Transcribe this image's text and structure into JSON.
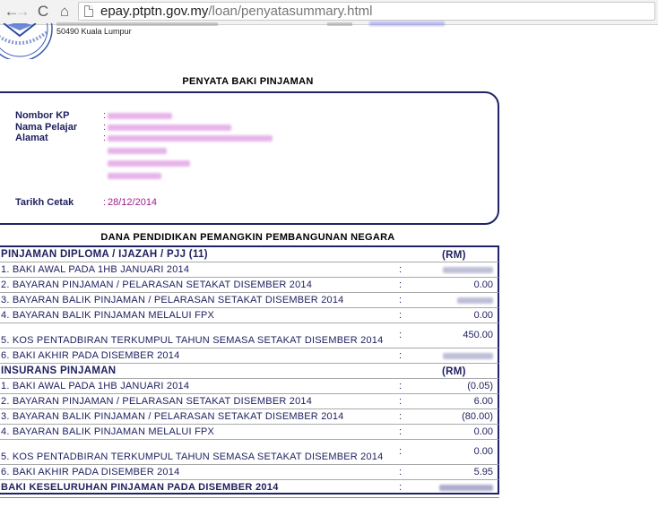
{
  "browser": {
    "back_glyph": "←",
    "forward_glyph": "→",
    "reload_glyph": "C",
    "home_glyph": "⌂",
    "url_host": "epay.ptptn.gov.my",
    "url_path": "/loan/penyatasummary.html"
  },
  "header": {
    "postcode_line": "50490 Kuala Lumpur"
  },
  "title": "PENYATA BAKI PINJAMAN",
  "info": {
    "nombor_kp_label": "Nombor KP",
    "nama_pelajar_label": "Nama Pelajar",
    "alamat_label": "Alamat",
    "tarikh_cetak_label": "Tarikh Cetak",
    "colon": ":",
    "tarikh_cetak_value": "28/12/2014"
  },
  "subtitle": "DANA PENDIDIKAN PEMANGKIN PEMBANGUNAN NEGARA",
  "loan": {
    "heading": "PINJAMAN DIPLOMA / IJAZAH / PJJ (11)",
    "currency": "(RM)",
    "rows": [
      {
        "desc": "1. BAKI AWAL PADA 1HB JANUARI 2014",
        "colon": ":",
        "amount": ""
      },
      {
        "desc": "2. BAYARAN PINJAMAN / PELARASAN SETAKAT DISEMBER 2014",
        "colon": ":",
        "amount": "0.00"
      },
      {
        "desc": "3. BAYARAN BALIK PINJAMAN / PELARASAN SETAKAT DISEMBER 2014",
        "colon": ":",
        "amount": ""
      },
      {
        "desc": "4. BAYARAN BALIK PINJAMAN MELALUI FPX",
        "colon": ":",
        "amount": "0.00"
      },
      {
        "desc": "5. KOS PENTADBIRAN TERKUMPUL TAHUN SEMASA SETAKAT DISEMBER 2014",
        "colon": ":",
        "amount": "450.00"
      },
      {
        "desc": "6. BAKI AKHIR PADA DISEMBER 2014",
        "colon": ":",
        "amount": ""
      }
    ]
  },
  "insurance": {
    "heading": "INSURANS PINJAMAN",
    "currency": "(RM)",
    "rows": [
      {
        "desc": "1. BAKI AWAL PADA 1HB JANUARI 2014",
        "colon": ":",
        "amount": "(0.05)"
      },
      {
        "desc": "2. BAYARAN PINJAMAN / PELARASAN SETAKAT DISEMBER 2014",
        "colon": ":",
        "amount": "6.00"
      },
      {
        "desc": "3. BAYARAN BALIK PINJAMAN / PELARASAN SETAKAT DISEMBER 2014",
        "colon": ":",
        "amount": "(80.00)"
      },
      {
        "desc": "4. BAYARAN BALIK PINJAMAN MELALUI FPX",
        "colon": ":",
        "amount": "0.00"
      },
      {
        "desc": "5. KOS PENTADBIRAN TERKUMPUL TAHUN SEMASA SETAKAT DISEMBER 2014",
        "colon": ":",
        "amount": "0.00"
      },
      {
        "desc": "6. BAKI AKHIR PADA DISEMBER 2014",
        "colon": ":",
        "amount": "5.95"
      }
    ]
  },
  "total": {
    "desc": "BAKI KESELURUHAN PINJAMAN PADA DISEMBER 2014",
    "colon": ":"
  }
}
